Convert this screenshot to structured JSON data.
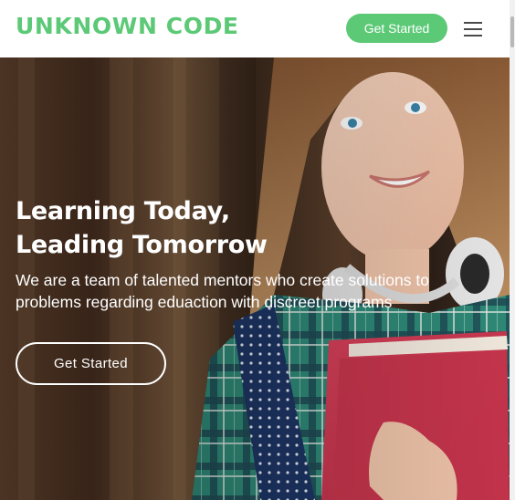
{
  "header": {
    "logo_text": "UNKNOWN CODE",
    "cta_label": "Get Started",
    "menu_icon": "hamburger-menu-icon"
  },
  "hero": {
    "title_line1": "Learning Today,",
    "title_line2": "Leading Tomorrow",
    "subtitle_line1": "We are a team of talented mentors who create solutions to",
    "subtitle_line2": "problems regarding eduaction with discreet programs",
    "cta_label": "Get Started",
    "image_subject": "smiling student with headphones holding red folders"
  },
  "colors": {
    "brand_green": "#5cc977",
    "header_bg": "#ffffff",
    "hero_text": "#ffffff",
    "menu_icon": "#4a4a4a"
  }
}
